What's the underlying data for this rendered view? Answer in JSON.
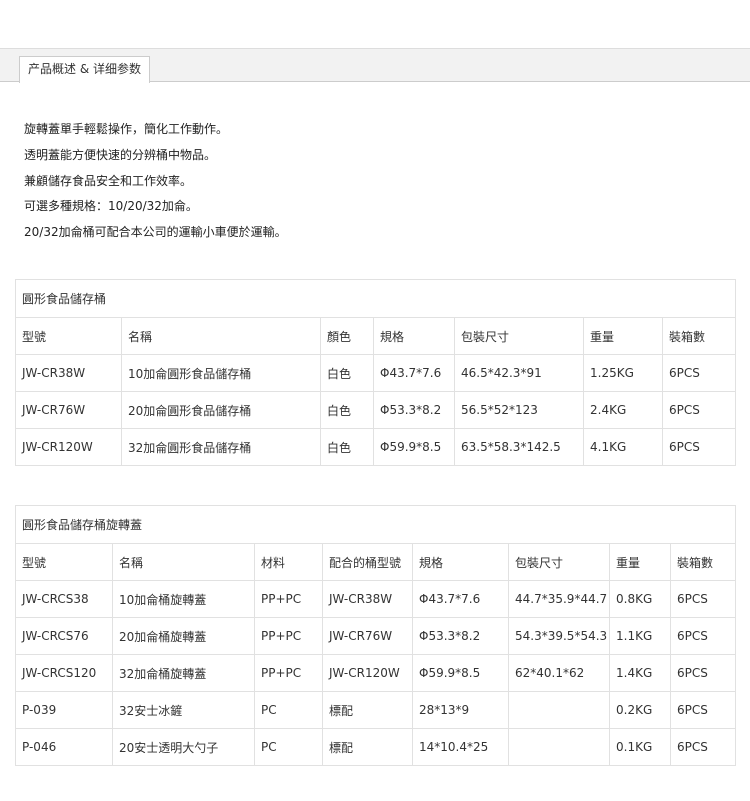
{
  "tab": {
    "label": "产品概述 & 详细参数"
  },
  "intro": [
    "旋轉蓋單手輕鬆操作，簡化工作動作。",
    "透明蓋能方便快速的分辨桶中物品。",
    "兼顧儲存食品安全和工作效率。",
    "可選多種規格：10/20/32加侖。",
    "20/32加侖桶可配合本公司的運輸小車便於運輸。"
  ],
  "table1": {
    "caption": "圓形食品儲存桶",
    "headers": [
      "型號",
      "名稱",
      "顏色",
      "規格",
      "包裝尺寸",
      "重量",
      "裝箱數"
    ],
    "rows": [
      [
        "JW-CR38W",
        "10加侖圓形食品儲存桶",
        "白色",
        "Φ43.7*7.6",
        "46.5*42.3*91",
        "1.25KG",
        "6PCS"
      ],
      [
        "JW-CR76W",
        "20加侖圓形食品儲存桶",
        "白色",
        "Φ53.3*8.2",
        "56.5*52*123",
        "2.4KG",
        "6PCS"
      ],
      [
        "JW-CR120W",
        "32加侖圓形食品儲存桶",
        "白色",
        "Φ59.9*8.5",
        "63.5*58.3*142.5",
        "4.1KG",
        "6PCS"
      ]
    ]
  },
  "table2": {
    "caption": "圓形食品儲存桶旋轉蓋",
    "headers": [
      "型號",
      "名稱",
      "材料",
      "配合的桶型號",
      "規格",
      "包裝尺寸",
      "重量",
      "裝箱數"
    ],
    "rows": [
      [
        "JW-CRCS38",
        "10加侖桶旋轉蓋",
        "PP+PC",
        "JW-CR38W",
        "Φ43.7*7.6",
        "44.7*35.9*44.7",
        "0.8KG",
        "6PCS"
      ],
      [
        "JW-CRCS76",
        "20加侖桶旋轉蓋",
        "PP+PC",
        "JW-CR76W",
        "Φ53.3*8.2",
        "54.3*39.5*54.3",
        "1.1KG",
        "6PCS"
      ],
      [
        "JW-CRCS120",
        "32加侖桶旋轉蓋",
        "PP+PC",
        "JW-CR120W",
        "Φ59.9*8.5",
        "62*40.1*62",
        "1.4KG",
        "6PCS"
      ],
      [
        "P-039",
        "32安士冰鏟",
        "PC",
        "標配",
        "28*13*9",
        "",
        "0.2KG",
        "6PCS"
      ],
      [
        "P-046",
        "20安士透明大勺子",
        "PC",
        "標配",
        "14*10.4*25",
        "",
        "0.1KG",
        "6PCS"
      ]
    ]
  }
}
